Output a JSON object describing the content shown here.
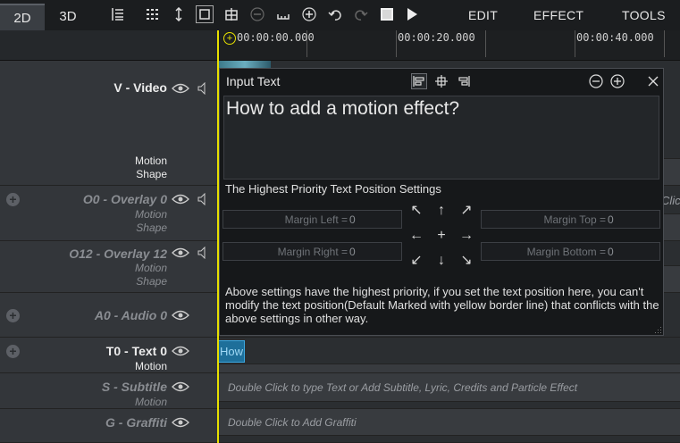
{
  "toolbar": {
    "tabs": [
      {
        "label": "2D",
        "active": true
      },
      {
        "label": "3D",
        "active": false
      }
    ],
    "menu": [
      "EDIT",
      "EFFECT",
      "TOOLS"
    ]
  },
  "ruler": {
    "timecodes": [
      "00:00:00.000",
      "00:00:20.000",
      "00:00:40.000"
    ]
  },
  "tracks": [
    {
      "title": "V - Video",
      "sub": [
        "Motion",
        "Shape"
      ],
      "has_speaker": true
    },
    {
      "title": "O0 - Overlay 0",
      "sub": [
        "Motion",
        "Shape"
      ],
      "has_speaker": true
    },
    {
      "title": "O12 - Overlay 12",
      "sub": [
        "Motion",
        "Shape"
      ],
      "has_speaker": true
    },
    {
      "title": "A0 - Audio 0"
    },
    {
      "title": "T0 - Text 0",
      "sub": [
        "Motion"
      ]
    },
    {
      "title": "S - Subtitle",
      "sub": [
        "Motion"
      ]
    },
    {
      "title": "G - Graffiti"
    }
  ],
  "lanes": {
    "subtitle_hint": "Double Click to type Text or Add Subtitle, Lyric, Credits and Particle Effect",
    "graffiti_hint": "Double Click to Add Graffiti",
    "overlay_hint_fragment": "Clic",
    "text_clip_label": "How"
  },
  "dialog": {
    "title": "Input Text",
    "text_value": "How to add a motion effect?",
    "section_label": "The Highest Priority Text Position Settings",
    "margin_left": {
      "label": "Margin Left =",
      "value": "0"
    },
    "margin_top": {
      "label": "Margin Top =",
      "value": "0"
    },
    "margin_right": {
      "label": "Margin Right =",
      "value": "0"
    },
    "margin_bottom": {
      "label": "Margin Bottom =",
      "value": "0"
    },
    "arrows": [
      "↖",
      "↑",
      "↗",
      "←",
      "+",
      "→",
      "↙",
      "↓",
      "↘"
    ],
    "note": "Above settings have the highest priority, if you set the text position here, you can't modify the text position(Default Marked with yellow border line) that conflicts with the above settings in other way."
  },
  "colors": {
    "playhead": "#e7e000",
    "text_clip": "#1e6f9a"
  }
}
